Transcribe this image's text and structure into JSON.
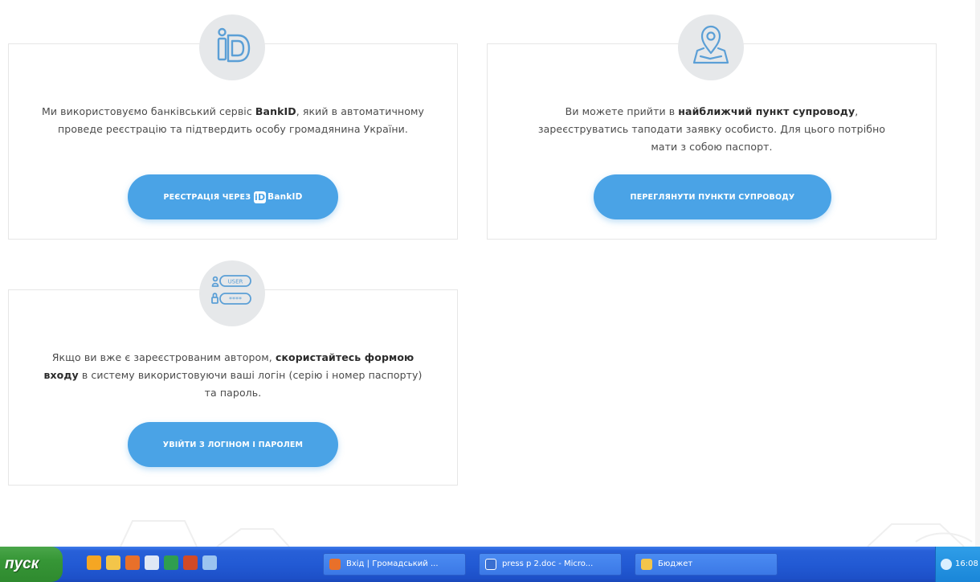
{
  "cards": {
    "bankid": {
      "text_before": "Ми використовуємо банківський сервіс ",
      "text_bold": "BankID",
      "text_after": ", який в автоматичному проведе реєстрацію та підтвердить особу громадянина України.",
      "button_label": "РЕЄСТРАЦІЯ ЧЕРЕЗ",
      "button_brand": "BankID",
      "icon": "bankid-logo-icon"
    },
    "support_point": {
      "text_before": "Ви можете прийти в ",
      "text_bold": "найближчий пункт супроводу",
      "text_after": ", зареєструватись таподати заявку особисто. Для цього потрібно мати з собою паспорт.",
      "button_label": "ПЕРЕГЛЯНУТИ ПУНКТИ СУПРОВОДУ",
      "icon": "map-pin-icon"
    },
    "login": {
      "text_before": "Якщо ви вже є зареєстрованим автором, ",
      "text_bold": "скористайтесь формою входу",
      "text_after": " в систему використовуючи ваші логін (серію і номер паспорту) та пароль.",
      "button_label": "УВІЙТИ З ЛОГІНОМ І ПАРОЛЕМ",
      "icon": "login-fields-icon",
      "icon_user_text": "USER",
      "icon_pass_text": "****"
    }
  },
  "taskbar": {
    "start_label": "пуск",
    "tasks": [
      {
        "label": "Вхід | Громадський ...",
        "icon": "firefox-icon"
      },
      {
        "label": "press p 2.doc - Micro...",
        "icon": "word-doc-icon"
      },
      {
        "label": "Бюджет",
        "icon": "folder-icon"
      }
    ],
    "clock": "16:08"
  },
  "colors": {
    "button": "#4aa3e6",
    "icon_circle": "#e6e8ea",
    "icon_stroke": "#5b9fd6",
    "taskbar": "#225ad4",
    "start": "#369636"
  }
}
